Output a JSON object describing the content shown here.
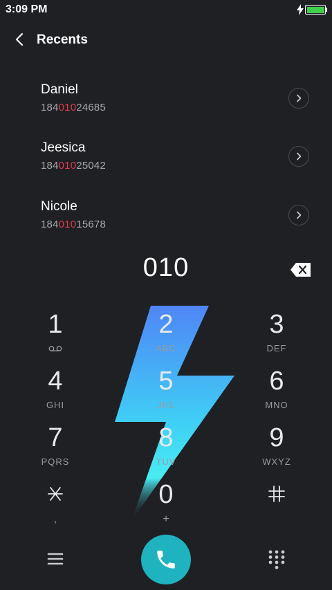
{
  "status_bar": {
    "time": "3:09 PM",
    "battery_color": "#3ed04a",
    "icons": [
      "charging-icon",
      "battery-icon"
    ]
  },
  "header": {
    "title": "Recents",
    "back_icon": "chevron-left-icon"
  },
  "recents": [
    {
      "name": "Daniel",
      "number_prefix": "184",
      "number_match": "010",
      "number_suffix": "24685"
    },
    {
      "name": "Jeesica",
      "number_prefix": "184",
      "number_match": "010",
      "number_suffix": "25042"
    },
    {
      "name": "Nicole",
      "number_prefix": "184",
      "number_match": "010",
      "number_suffix": "15678"
    }
  ],
  "dialer": {
    "input": "010",
    "backspace_icon": "backspace-icon",
    "keys": [
      {
        "digit": "1",
        "letters": ""
      },
      {
        "digit": "2",
        "letters": "ABC"
      },
      {
        "digit": "3",
        "letters": "DEF"
      },
      {
        "digit": "4",
        "letters": "GHI"
      },
      {
        "digit": "5",
        "letters": "JKL"
      },
      {
        "digit": "6",
        "letters": "MNO"
      },
      {
        "digit": "7",
        "letters": "PQRS"
      },
      {
        "digit": "8",
        "letters": "TUV"
      },
      {
        "digit": "9",
        "letters": "WXYZ"
      },
      {
        "digit": "*",
        "letters": ","
      },
      {
        "digit": "0",
        "letters": "+"
      },
      {
        "digit": "#",
        "letters": ""
      }
    ]
  },
  "bottom_bar": {
    "icons": [
      "menu-icon",
      "phone-icon",
      "dialpad-icon"
    ],
    "call_color": "#1eb3be"
  },
  "colors": {
    "background": "#1e2024",
    "match_highlight": "#e0394e",
    "bolt_top": "#4f86f6",
    "bolt_bottom": "#43e6f4"
  }
}
